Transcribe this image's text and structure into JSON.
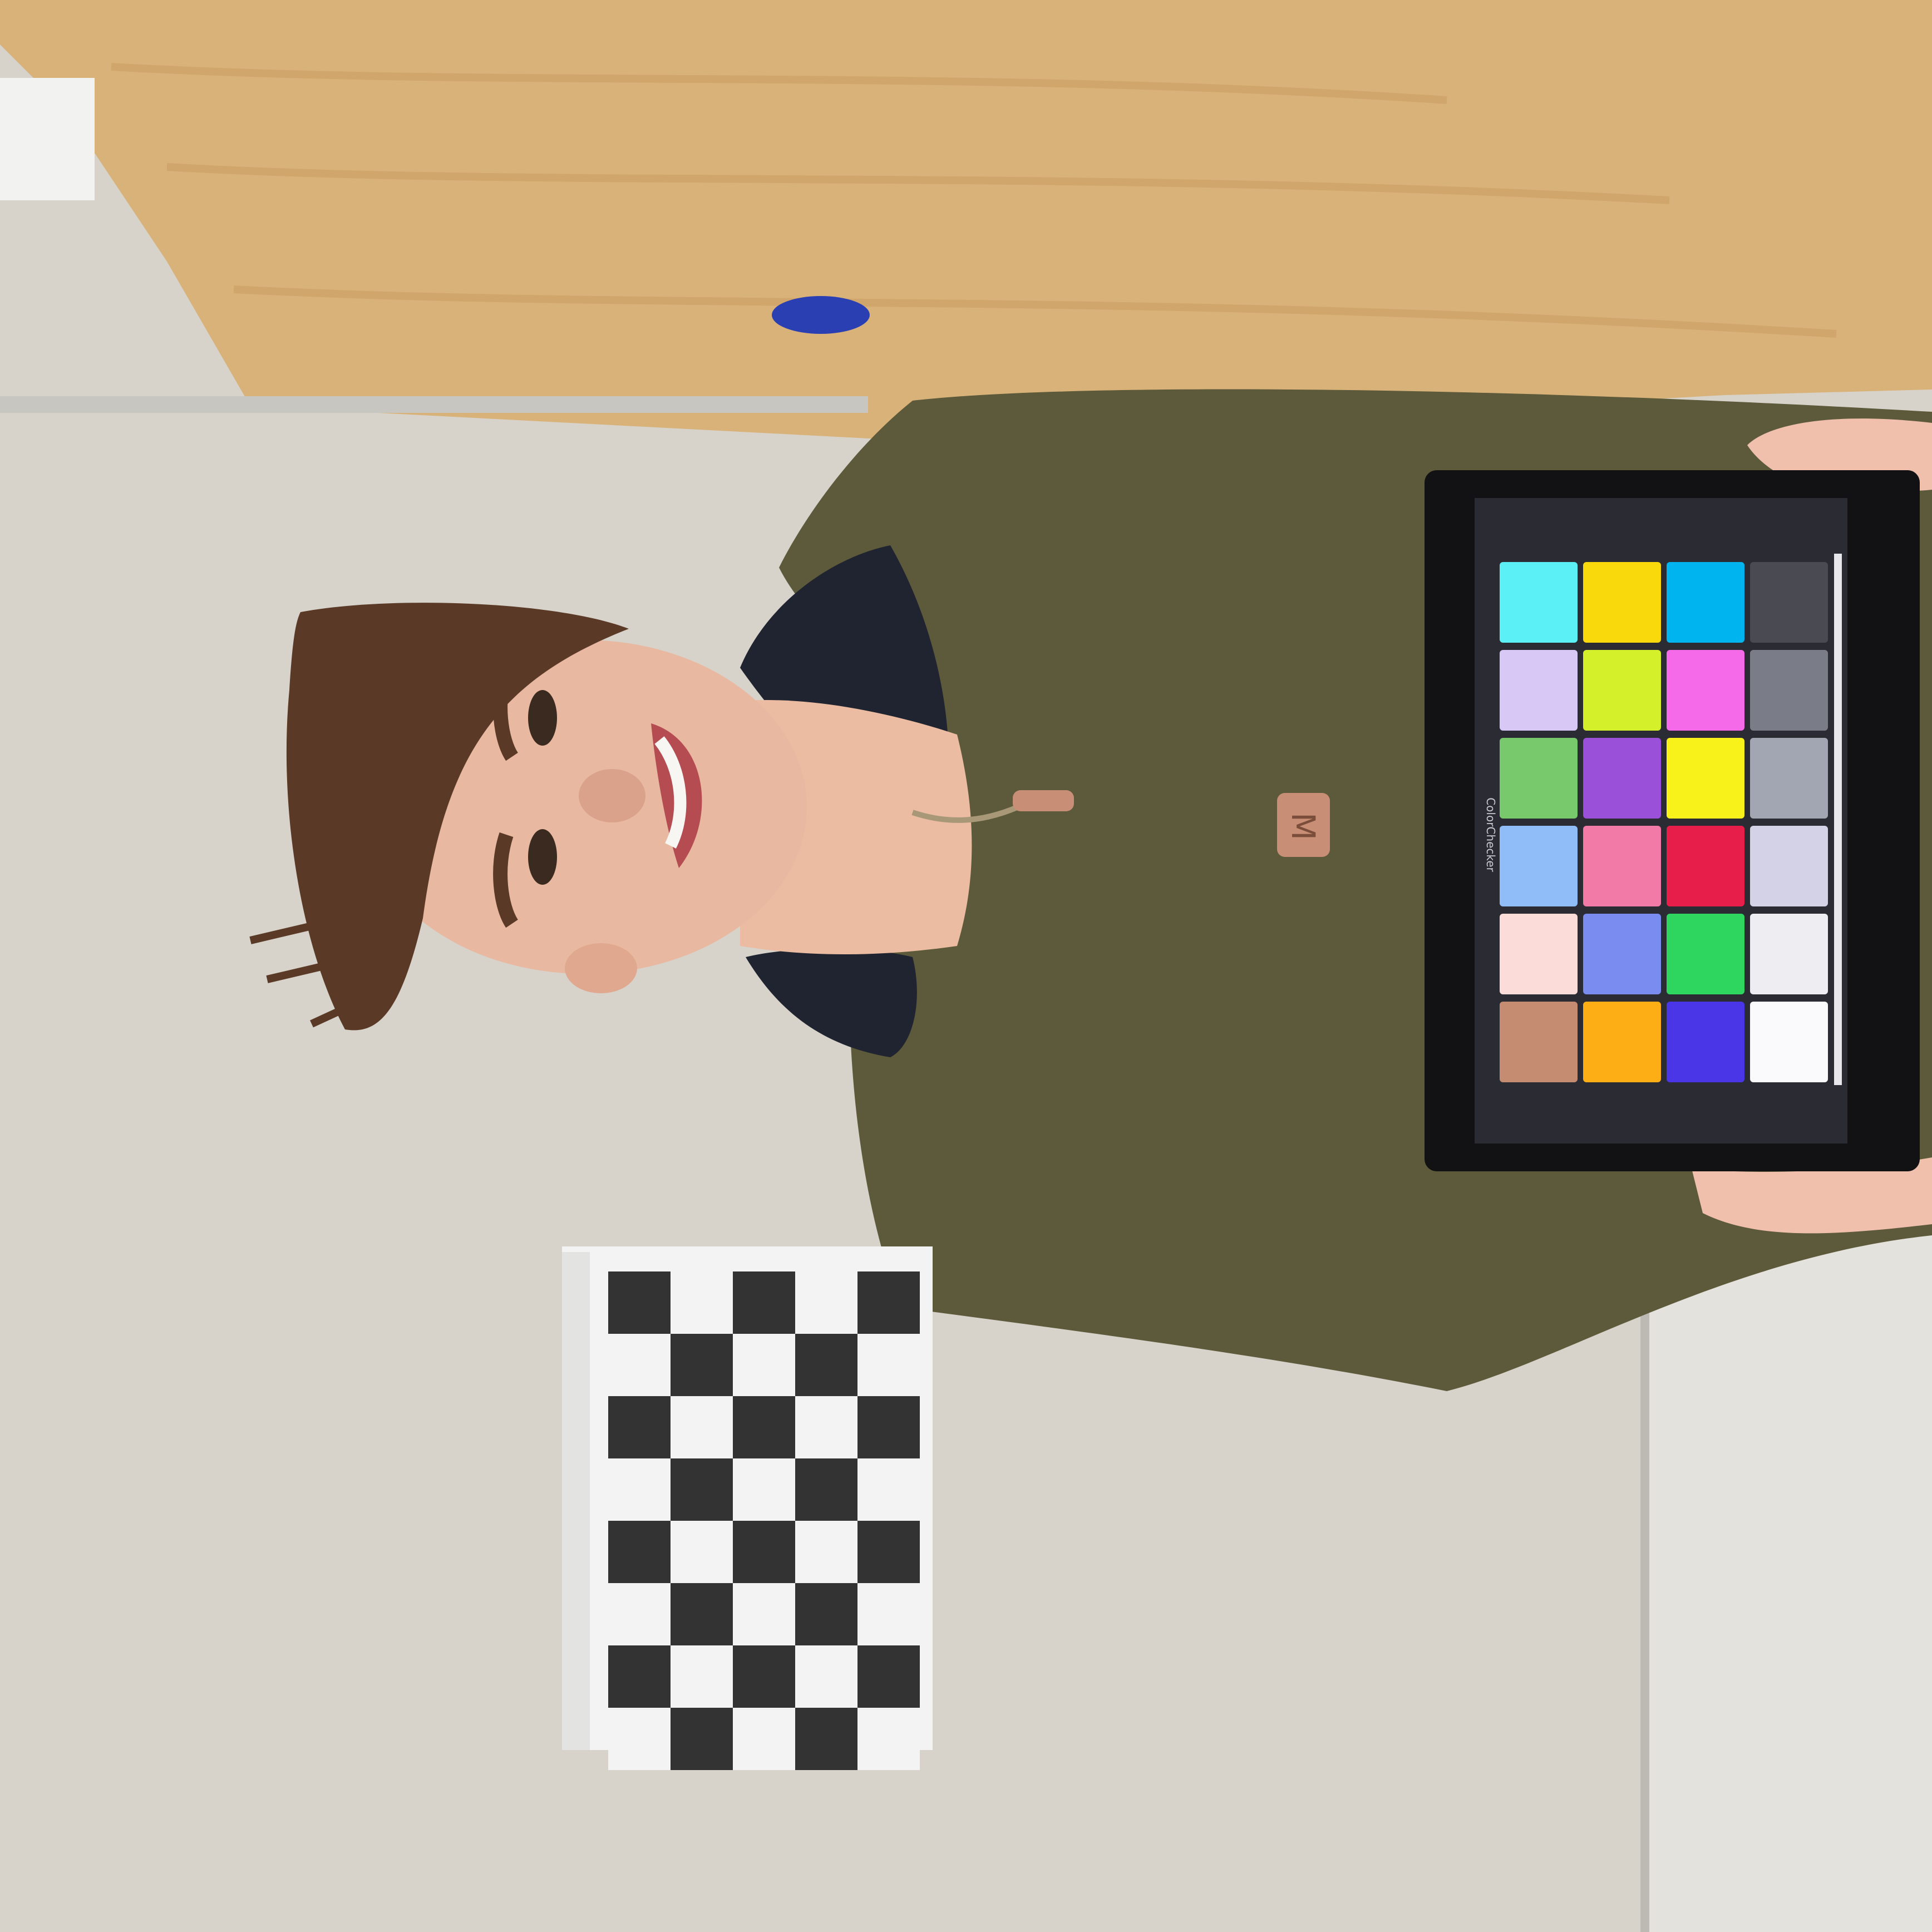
{
  "scene": {
    "orientation": "rotated-90-clockwise",
    "wall_color": "#d7d3cb",
    "door_color": "#d9b27a",
    "sticker_color": "#2a3fb2",
    "sweater_color": "#5c5a3a",
    "skin_color": "#e8b8a0",
    "hair_color": "#5a3a26"
  },
  "patch": {
    "letter": "M"
  },
  "tablet": {
    "app_label": "ColorChecker",
    "bezel_color": "#121214",
    "screen_color": "#2b2b33",
    "swatch_rows": [
      [
        "#5af0f5",
        "#f9d80c",
        "#00b4f0",
        "#4a4a52"
      ],
      [
        "#d8c8f5",
        "#d4f02a",
        "#f56ae8",
        "#7a7c88"
      ],
      [
        "#78c86c",
        "#9a50d8",
        "#f8f21a",
        "#a2a6b2"
      ],
      [
        "#90bdf8",
        "#f27aa6",
        "#e81e4a",
        "#d4d2e6"
      ],
      [
        "#fcdcd8",
        "#7a8cf0",
        "#2ed660",
        "#eeeef2"
      ],
      [
        "#c68c72",
        "#fcae14",
        "#4a36e6",
        "#fafafc"
      ]
    ]
  },
  "checkerboard": {
    "rows": 8,
    "cols": 5,
    "dark_color": "#333333",
    "light_color": "#f3f3f3"
  }
}
